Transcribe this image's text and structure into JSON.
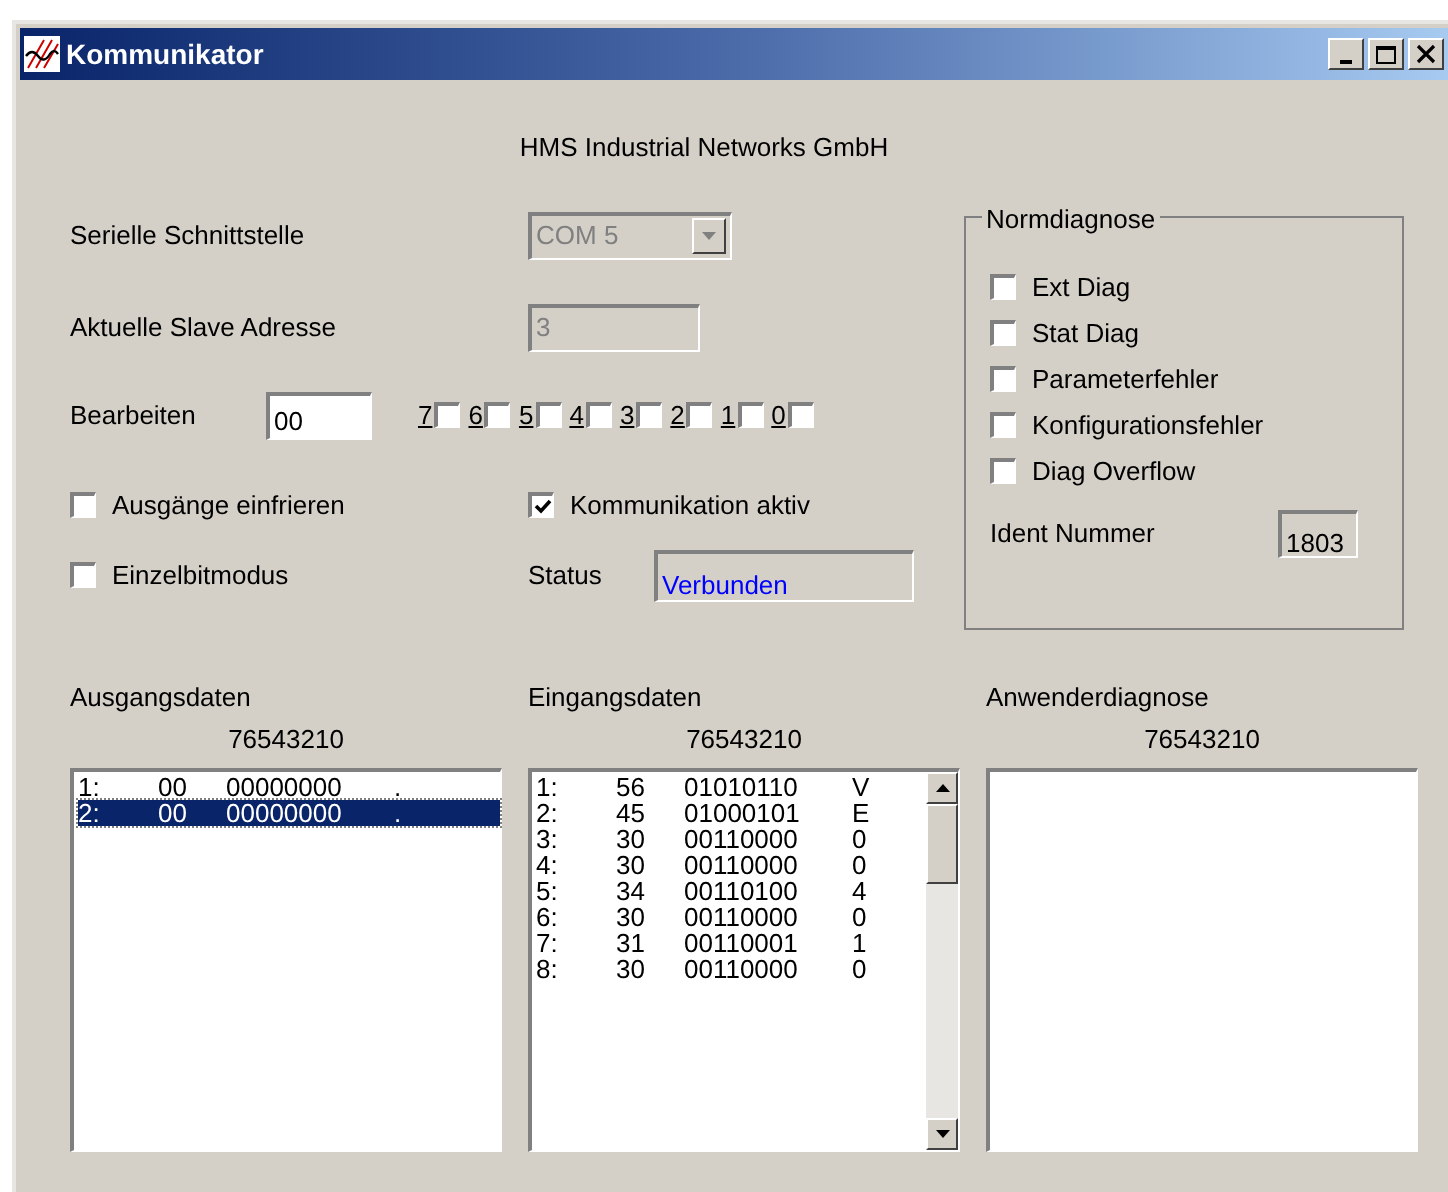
{
  "window": {
    "title": "Kommunikator",
    "buttons": [
      {
        "kind": "minimize"
      },
      {
        "kind": "maximize"
      },
      {
        "kind": "close"
      }
    ]
  },
  "company": "HMS Industrial Networks GmbH",
  "serial": {
    "label": "Serielle Schnittstelle",
    "value": "COM 5",
    "disabled": true
  },
  "slave": {
    "label": "Aktuelle Slave Adresse",
    "value": "3",
    "disabled": true
  },
  "edit": {
    "label": "Bearbeiten",
    "value": "00",
    "bits": [
      {
        "label": "7",
        "checked": false
      },
      {
        "label": "6",
        "checked": false
      },
      {
        "label": "5",
        "checked": false
      },
      {
        "label": "4",
        "checked": false
      },
      {
        "label": "3",
        "checked": false
      },
      {
        "label": "2",
        "checked": false
      },
      {
        "label": "1",
        "checked": false
      },
      {
        "label": "0",
        "checked": false
      }
    ]
  },
  "options": [
    {
      "label": "Ausgänge einfrieren",
      "checked": false
    },
    {
      "label": "Kommunikation aktiv",
      "checked": true
    },
    {
      "label": "Einzelbitmodus",
      "checked": false
    }
  ],
  "status": {
    "label": "Status",
    "value": "Verbunden"
  },
  "normdiagnose": {
    "title": "Normdiagnose",
    "items": [
      {
        "label": "Ext Diag",
        "checked": false
      },
      {
        "label": "Stat Diag",
        "checked": false
      },
      {
        "label": "Parameterfehler",
        "checked": false
      },
      {
        "label": "Konfigurationsfehler",
        "checked": false
      },
      {
        "label": "Diag Overflow",
        "checked": false
      }
    ],
    "ident_label": "Ident Nummer",
    "ident_value": "1803"
  },
  "lists": [
    {
      "title": "Ausgangsdaten",
      "header": "76543210",
      "scrollbar": false,
      "rows": [
        {
          "index": "1:",
          "hex": "00",
          "bin": "00000000",
          "char": ".",
          "selected": false
        },
        {
          "index": "2:",
          "hex": "00",
          "bin": "00000000",
          "char": ".",
          "selected": true
        }
      ]
    },
    {
      "title": "Eingangsdaten",
      "header": "76543210",
      "scrollbar": true,
      "rows": [
        {
          "index": "1:",
          "hex": "56",
          "bin": "01010110",
          "char": "V",
          "selected": false
        },
        {
          "index": "2:",
          "hex": "45",
          "bin": "01000101",
          "char": "E",
          "selected": false
        },
        {
          "index": "3:",
          "hex": "30",
          "bin": "00110000",
          "char": "0",
          "selected": false
        },
        {
          "index": "4:",
          "hex": "30",
          "bin": "00110000",
          "char": "0",
          "selected": false
        },
        {
          "index": "5:",
          "hex": "34",
          "bin": "00110100",
          "char": "4",
          "selected": false
        },
        {
          "index": "6:",
          "hex": "30",
          "bin": "00110000",
          "char": "0",
          "selected": false
        },
        {
          "index": "7:",
          "hex": "31",
          "bin": "00110001",
          "char": "1",
          "selected": false
        },
        {
          "index": "8:",
          "hex": "30",
          "bin": "00110000",
          "char": "0",
          "selected": false
        }
      ]
    },
    {
      "title": "Anwenderdiagnose",
      "header": "76543210",
      "scrollbar": false
    }
  ]
}
